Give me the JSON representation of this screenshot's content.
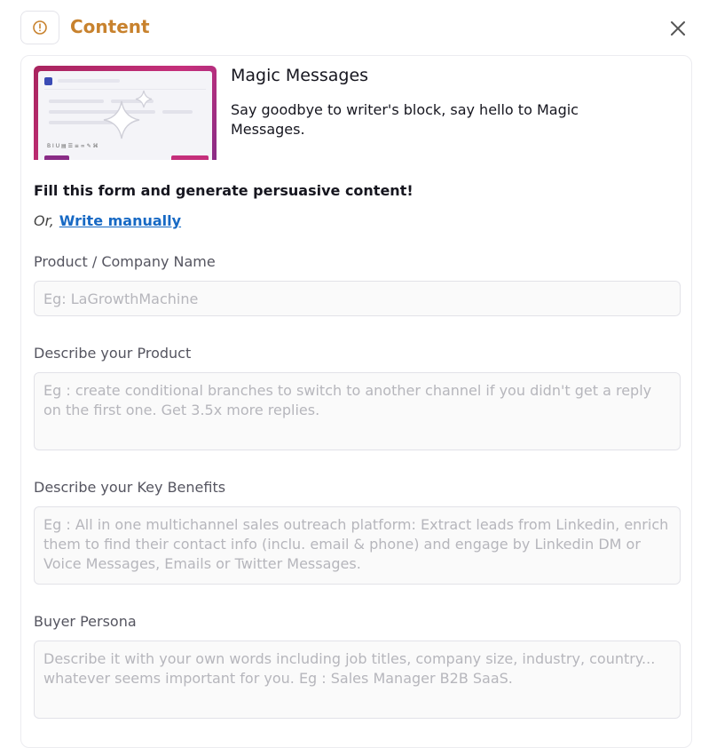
{
  "header": {
    "title": "Content"
  },
  "promo": {
    "title": "Magic Messages",
    "subtitle": "Say goodbye to writer's block, say hello to Magic Messages."
  },
  "form": {
    "intro": "Fill this form and generate persuasive content!",
    "or_text": "Or,",
    "write_manually": "Write manually",
    "fields": [
      {
        "label": "Product / Company Name",
        "value": "",
        "placeholder": "Eg: LaGrowthMachine"
      },
      {
        "label": "Describe your Product",
        "value": "",
        "placeholder": "Eg : create conditional branches to switch to another channel if you didn't get a reply on the first one. Get 3.5x more replies."
      },
      {
        "label": "Describe your Key Benefits",
        "value": "",
        "placeholder": "Eg : All in one multichannel sales outreach platform: Extract leads from Linkedin, enrich them to find their contact info (inclu. email & phone) and engage by Linkedin DM or Voice Messages, Emails or Twitter Messages."
      },
      {
        "label": "Buyer Persona",
        "value": "",
        "placeholder": "Describe it with your own words including job titles, company size, industry, country... whatever seems important for you. Eg : Sales Manager B2B SaaS."
      }
    ]
  },
  "colors": {
    "accent": "#c8822e",
    "link": "#1769c4",
    "thumb_gradient_start": "#a8245e",
    "thumb_gradient_end": "#8a2c86"
  },
  "icons": {
    "header": "alert-circle-icon",
    "close": "close-icon",
    "thumb_sparkle": "sparkle-icon",
    "thumb_brand": "linkedin-icon"
  }
}
